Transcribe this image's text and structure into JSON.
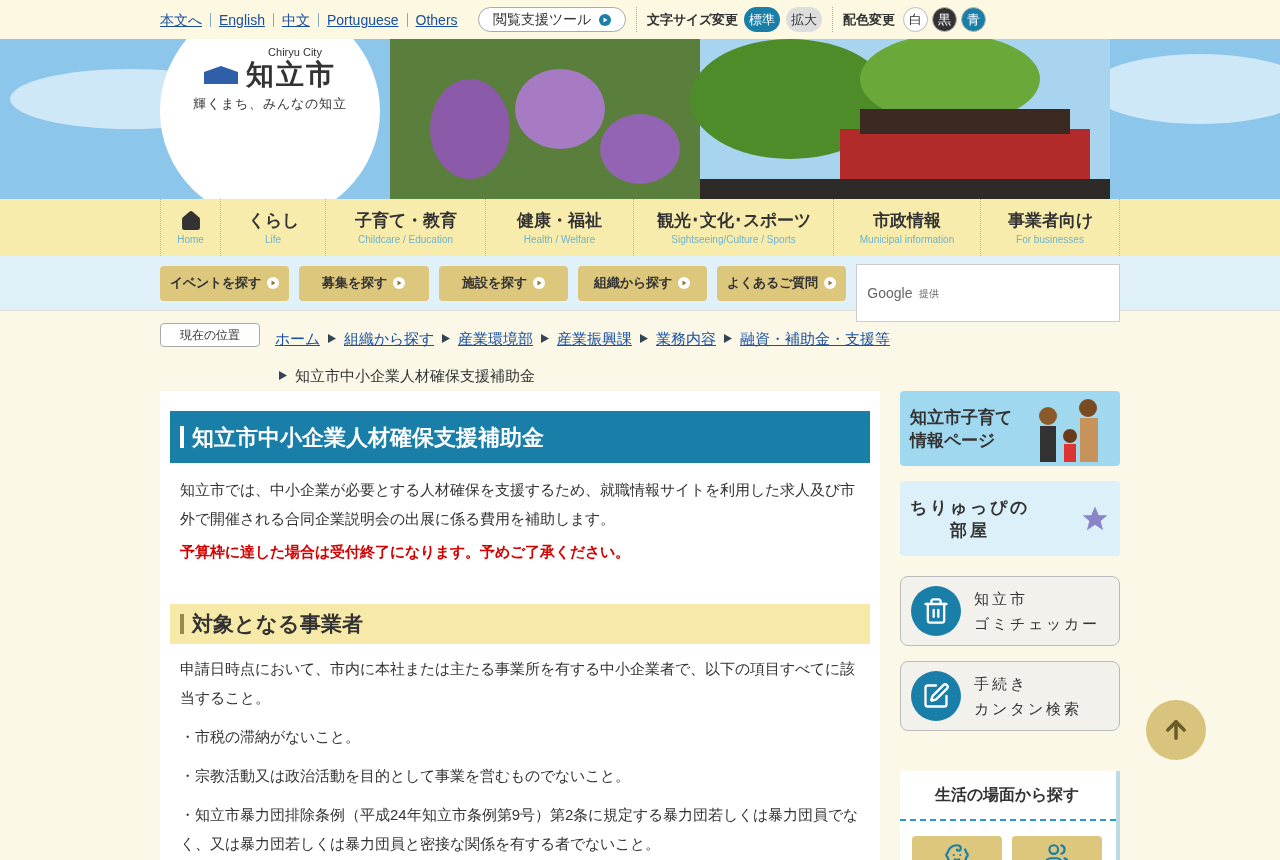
{
  "top_links": [
    {
      "label": "本文へ"
    },
    {
      "label": "English"
    },
    {
      "label": "中文"
    },
    {
      "label": "Portuguese"
    },
    {
      "label": "Others"
    }
  ],
  "reading_tool": "閲覧支援ツール",
  "font_size": {
    "label": "文字サイズ変更",
    "options": [
      {
        "label": "標準",
        "selected": true
      },
      {
        "label": "拡大",
        "selected": false
      }
    ]
  },
  "color_change": {
    "label": "配色変更",
    "options": [
      {
        "label": "白",
        "color": "#ffffff"
      },
      {
        "label": "黒",
        "color": "#333333"
      },
      {
        "label": "青",
        "color": "#1a7fa8"
      }
    ]
  },
  "logo": {
    "sub": "Chiryu City",
    "name": "知立市",
    "tagline": "輝くまち、みんなの知立"
  },
  "nav": [
    {
      "kind": "home",
      "en": "Home"
    },
    {
      "kind": "text",
      "ja": "くらし",
      "en": "Life"
    },
    {
      "kind": "text",
      "ja": "子育て・教育",
      "en": "Childcare / Education"
    },
    {
      "kind": "text",
      "ja": "健康・福祉",
      "en": "Health / Welfare"
    },
    {
      "kind": "text",
      "ja": "観光･文化･スポーツ",
      "en": "Sightseeing/Culture / Sports"
    },
    {
      "kind": "text",
      "ja": "市政情報",
      "en": "Municipal information"
    },
    {
      "kind": "text",
      "ja": "事業者向け",
      "en": "For businesses"
    }
  ],
  "quick_buttons": [
    "イベントを探す",
    "募集を探す",
    "施設を探す",
    "組織から探す",
    "よくあるご質問"
  ],
  "search": {
    "brand": "Google",
    "suffix": "提供"
  },
  "breadcrumb": {
    "label": "現在の位置",
    "links": [
      "ホーム",
      "組織から探す",
      "産業環境部",
      "産業振興課",
      "業務内容",
      "融資・補助金・支援等"
    ],
    "current": "知立市中小企業人材確保支援補助金"
  },
  "article": {
    "title": "知立市中小企業人材確保支援補助金",
    "intro": "知立市では、中小企業が必要とする人材確保を支援するため、就職情報サイトを利用した求人及び市外で開催される合同企業説明会の出展に係る費用を補助します。",
    "notice": "予算枠に達した場合は受付終了になります。予めご了承ください。",
    "section": "対象となる事業者",
    "paragraphs": [
      "申請日時点において、市内に本社または主たる事業所を有する中小企業者で、以下の項目すべてに該当すること。",
      "・市税の滞納がないこと。",
      "・宗教活動又は政治活動を目的として事業を営むものでないこと。",
      "・知立市暴力団排除条例（平成24年知立市条例第9号）第2条に規定する暴力団若しくは暴力団員でなく、又は暴力団若しくは暴力団員と密接な関係を有する者でないこと。"
    ]
  },
  "sidebar": {
    "banners": [
      {
        "kind": "family",
        "lines": [
          "知立市子育て",
          "情報ページ"
        ]
      },
      {
        "kind": "room",
        "lines": [
          "ちりゅっぴの",
          "部屋"
        ]
      }
    ],
    "tools": [
      {
        "kind": "trash",
        "lines": [
          "知立市",
          "ゴミチェッカー"
        ]
      },
      {
        "kind": "edit",
        "lines": [
          "手続き",
          "カンタン検索"
        ]
      }
    ],
    "scene_title": "生活の場面から探す"
  }
}
